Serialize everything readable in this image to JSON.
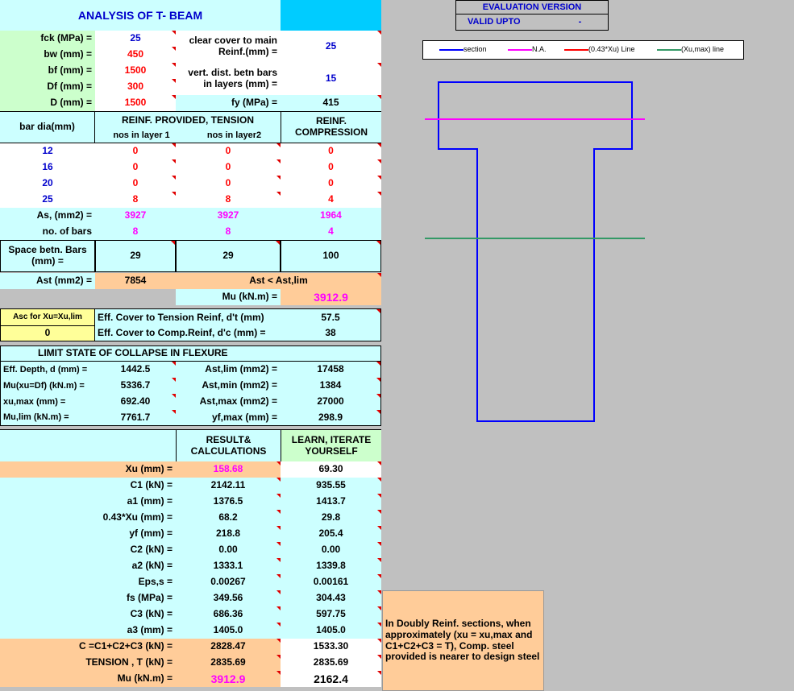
{
  "title": "ANALYSIS OF T- BEAM",
  "evaluation": {
    "version_label": "EVALUATION VERSION",
    "valid_label": "VALID UPTO",
    "valid_value": "-"
  },
  "legend": [
    "section",
    "N.A.",
    "(0.43*Xu) Line",
    "(Xu,max) line"
  ],
  "colors": {
    "section": "#0000ff",
    "na": "#ff00ff",
    "xu43": "#ff0000",
    "xumax": "#339966"
  },
  "inputs": {
    "fck_label": "fck (MPa) =",
    "fck": "25",
    "bw_label": "bw (mm) =",
    "bw": "450",
    "bf_label": "bf (mm) =",
    "bf": "1500",
    "df_label": "Df (mm) =",
    "df": "300",
    "d_label": "D (mm) =",
    "d": "1500",
    "cover_label": "clear cover to main\nReinf.(mm) =",
    "cover": "25",
    "vert_label": "vert. dist. betn bars\nin layers (mm) =",
    "vert": "15",
    "fy_label": "fy (MPa) =",
    "fy": "415"
  },
  "reinf": {
    "bar_dia_label": "bar dia(mm)",
    "tension_label": "REINF. PROVIDED, TENSION",
    "layer1_label": "nos in layer 1",
    "layer2_label": "nos in layer2",
    "comp_label": "REINF.\nCOMPRESSION",
    "rows": [
      {
        "dia": "12",
        "l1": "0",
        "l2": "0",
        "comp": "0"
      },
      {
        "dia": "16",
        "l1": "0",
        "l2": "0",
        "comp": "0"
      },
      {
        "dia": "20",
        "l1": "0",
        "l2": "0",
        "comp": "0"
      },
      {
        "dia": "25",
        "l1": "8",
        "l2": "8",
        "comp": "4"
      }
    ],
    "as_label": "As, (mm2) =",
    "as_l1": "3927",
    "as_l2": "3927",
    "as_comp": "1964",
    "nbars_label": "no. of bars",
    "n_l1": "8",
    "n_l2": "8",
    "n_comp": "4",
    "space_label": "Space betn. Bars\n(mm) =",
    "sp_l1": "29",
    "sp_l2": "29",
    "sp_comp": "100",
    "ast_label": "Ast (mm2) =",
    "ast": "7854",
    "ast_check": "Ast < Ast,lim",
    "mu_label": "Mu (kN.m) =",
    "mu": "3912.9"
  },
  "asc": {
    "label": "Asc for Xu=Xu,lim",
    "value": "0",
    "eff_t_label": "Eff. Cover to Tension Reinf, d't (mm)",
    "eff_t": "57.5",
    "eff_c_label": "Eff. Cover to Comp.Reinf, d'c (mm) =",
    "eff_c": "38"
  },
  "limit": {
    "header": "LIMIT STATE OF COLLAPSE IN FLEXURE",
    "rows": [
      {
        "l1": "Eff. Depth, d (mm) =",
        "v1": "1442.5",
        "l2": "Ast,lim (mm2) =",
        "v2": "17458"
      },
      {
        "l1": "Mu(xu=Df) (kN.m) =",
        "v1": "5336.7",
        "l2": "Ast,min (mm2) =",
        "v2": "1384"
      },
      {
        "l1": "xu,max (mm) =",
        "v1": "692.40",
        "l2": "Ast,max  (mm2) =",
        "v2": "27000"
      },
      {
        "l1": "Mu,lim (kN.m) =",
        "v1": "7761.7",
        "l2": "yf,max (mm) =",
        "v2": "298.9"
      }
    ]
  },
  "results": {
    "col1": "RESULT&\nCALCULATIONS",
    "col2": "LEARN, ITERATE\nYOURSELF",
    "rows": [
      {
        "label": "Xu (mm) =",
        "v1": "158.68",
        "v2": "69.30"
      },
      {
        "label": "C1 (kN) =",
        "v1": "2142.11",
        "v2": "935.55"
      },
      {
        "label": "a1 (mm) =",
        "v1": "1376.5",
        "v2": "1413.7"
      },
      {
        "label": "0.43*Xu (mm) =",
        "v1": "68.2",
        "v2": "29.8"
      },
      {
        "label": "yf (mm) =",
        "v1": "218.8",
        "v2": "205.4"
      },
      {
        "label": "C2 (kN) =",
        "v1": "0.00",
        "v2": "0.00"
      },
      {
        "label": "a2 (kN) =",
        "v1": "1333.1",
        "v2": "1339.8"
      },
      {
        "label": "Eps,s  =",
        "v1": "0.00267",
        "v2": "0.00161"
      },
      {
        "label": "fs (MPa) =",
        "v1": "349.56",
        "v2": "304.43"
      },
      {
        "label": "C3 (kN)   =",
        "v1": "686.36",
        "v2": "597.75"
      },
      {
        "label": "a3 (mm) =",
        "v1": "1405.0",
        "v2": "1405.0"
      },
      {
        "label": "C =C1+C2+C3 (kN) =",
        "v1": "2828.47",
        "v2": "1533.30"
      },
      {
        "label": "TENSION , T (kN) =",
        "v1": "2835.69",
        "v2": "2835.69"
      },
      {
        "label": "Mu (kN.m) =",
        "v1": "3912.9",
        "v2": "2162.4"
      }
    ]
  },
  "note": "In Doubly Reinf. sections, when approximately (xu = xu,max and C1+C2+C3 = T), Comp. steel provided is nearer to design steel"
}
